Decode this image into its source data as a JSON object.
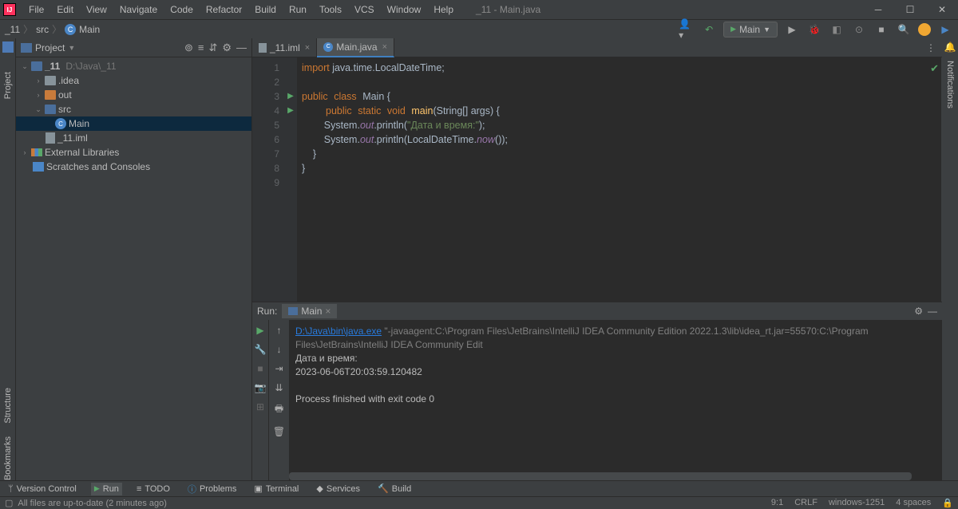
{
  "window": {
    "title": "_11 - Main.java"
  },
  "menu": [
    "File",
    "Edit",
    "View",
    "Navigate",
    "Code",
    "Refactor",
    "Build",
    "Run",
    "Tools",
    "VCS",
    "Window",
    "Help"
  ],
  "breadcrumb": {
    "root": "_11",
    "folder": "src",
    "file": "Main"
  },
  "runConfig": {
    "label": "Main"
  },
  "sidebar": {
    "title": "Project",
    "tree": {
      "root": {
        "name": "_11",
        "path": "D:\\Java\\_11"
      },
      "idea": ".idea",
      "out": "out",
      "src": "src",
      "main": "Main",
      "iml": "_11.iml",
      "ext": "External Libraries",
      "scratch": "Scratches and Consoles"
    }
  },
  "tabs": [
    {
      "label": "_11.iml",
      "active": false
    },
    {
      "label": "Main.java",
      "active": true
    }
  ],
  "code": {
    "lines": [
      1,
      2,
      3,
      4,
      5,
      6,
      7,
      8,
      9
    ],
    "l1": {
      "kw": "import",
      "rest": " java.time.LocalDateTime;"
    },
    "l3": {
      "kw1": "public",
      "kw2": "class",
      "cls": "Main",
      "brace": " {"
    },
    "l4": {
      "kw1": "public",
      "kw2": "static",
      "kw3": "void",
      "fn": "main",
      "args": "(String[] args) {"
    },
    "l5": {
      "pre": "        System.",
      "field": "out",
      "mid": ".println(",
      "str": "\"Дата и время:\"",
      "end": ");"
    },
    "l6": {
      "pre": "        System.",
      "field": "out",
      "mid": ".println(LocalDateTime.",
      "call": "now",
      "end": "());"
    },
    "l7": "    }",
    "l8": "}"
  },
  "run": {
    "label": "Run:",
    "tab": "Main",
    "exe": "D:\\Java\\bin\\java.exe",
    "args": " \"-javaagent:C:\\Program Files\\JetBrains\\IntelliJ IDEA Community Edition 2022.1.3\\lib\\idea_rt.jar=55570:C:\\Program Files\\JetBrains\\IntelliJ IDEA Community Edit",
    "out1": "Дата и время:",
    "out2": "2023-06-06T20:03:59.120482",
    "exit": "Process finished with exit code 0"
  },
  "bottomTabs": {
    "vc": "Version Control",
    "run": "Run",
    "todo": "TODO",
    "problems": "Problems",
    "terminal": "Terminal",
    "services": "Services",
    "build": "Build"
  },
  "status": {
    "msg": "All files are up-to-date (2 minutes ago)",
    "pos": "9:1",
    "sep": "CRLF",
    "enc": "windows-1251",
    "indent": "4 spaces"
  },
  "leftLabels": {
    "project": "Project",
    "structure": "Structure",
    "bookmarks": "Bookmarks"
  },
  "rightLabels": {
    "notif": "Notifications"
  }
}
